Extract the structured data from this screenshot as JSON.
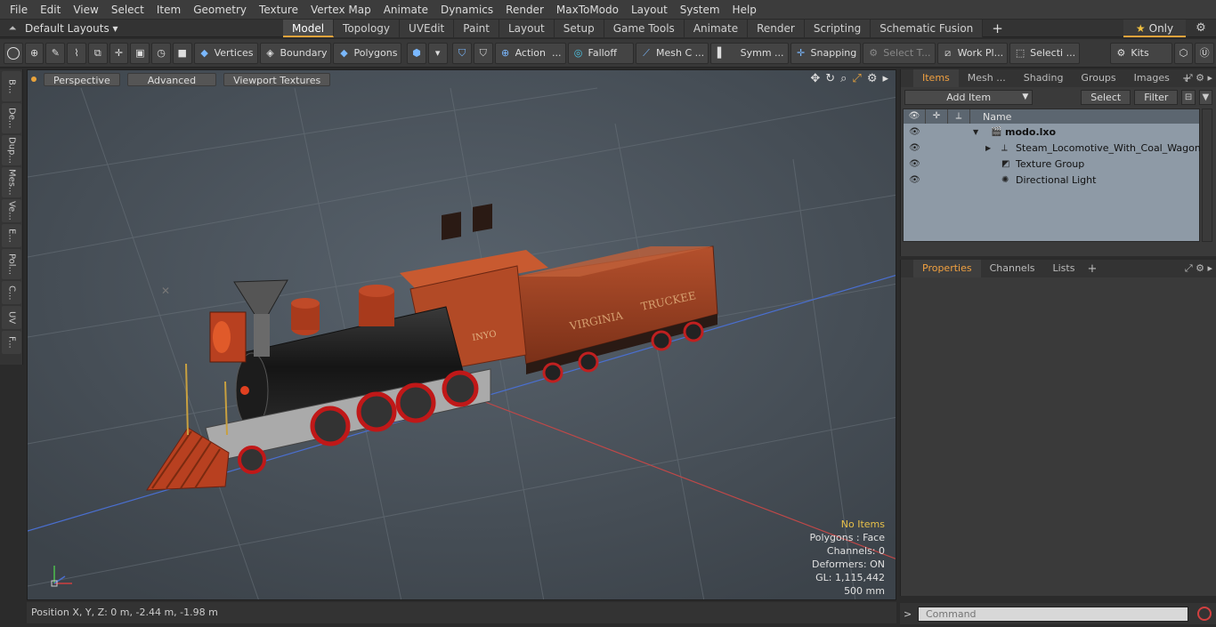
{
  "menubar": {
    "items": [
      "File",
      "Edit",
      "View",
      "Select",
      "Item",
      "Geometry",
      "Texture",
      "Vertex Map",
      "Animate",
      "Dynamics",
      "Render",
      "MaxToModo",
      "Layout",
      "System",
      "Help"
    ]
  },
  "layoutbar": {
    "layout_select": "Default Layouts ▾",
    "tabs": [
      "Model",
      "Topology",
      "UVEdit",
      "Paint",
      "Layout",
      "Setup",
      "Game Tools",
      "Animate",
      "Render",
      "Scripting",
      "Schematic Fusion"
    ],
    "active_tab": "Model",
    "plus": "+",
    "only_label": "Only"
  },
  "toolbar": {
    "vertices": "Vertices",
    "boundary": "Boundary",
    "polygons": "Polygons",
    "action": "Action",
    "falloff": "Falloff",
    "mesh_c": "Mesh C ...",
    "symm": "Symm ...",
    "snapping": "Snapping",
    "select_t": "Select T...",
    "work_pl": "Work Pl...",
    "selecti": "Selecti ...",
    "kits": "Kits",
    "action_more": "..."
  },
  "lefttabs": [
    "B...",
    "De...",
    "Dup...",
    "Mes...",
    "Ve...",
    "E...",
    "Pol...",
    "C...",
    "UV",
    "F..."
  ],
  "viewport": {
    "perspective": "Perspective",
    "advanced": "Advanced",
    "viewport_textures": "Viewport Textures",
    "stats": {
      "no_items": "No Items",
      "polygons": "Polygons : Face",
      "channels": "Channels: 0",
      "deformers": "Deformers: ON",
      "gl": "GL: 1,115,442",
      "scale": "500 mm"
    },
    "model_text_1": "VIRGINIA",
    "model_text_2": "TRUCKEE",
    "cab_text": "INYO"
  },
  "statusbar": {
    "position": "Position X, Y, Z:   0 m, -2.44 m, -1.98 m"
  },
  "items_panel": {
    "tabs": [
      "Items",
      "Mesh ...",
      "Shading",
      "Groups",
      "Images"
    ],
    "active_tab": "Items",
    "add_item": "Add Item",
    "select": "Select",
    "filter": "Filter",
    "name_header": "Name",
    "rows": [
      {
        "label": "modo.lxo"
      },
      {
        "label": "Steam_Locomotive_With_Coal_Wagon"
      },
      {
        "label": "Texture Group"
      },
      {
        "label": "Directional Light"
      }
    ]
  },
  "props_panel": {
    "tabs": [
      "Properties",
      "Channels",
      "Lists"
    ],
    "active_tab": "Properties"
  },
  "command": {
    "placeholder": "Command",
    "prompt": ">"
  }
}
